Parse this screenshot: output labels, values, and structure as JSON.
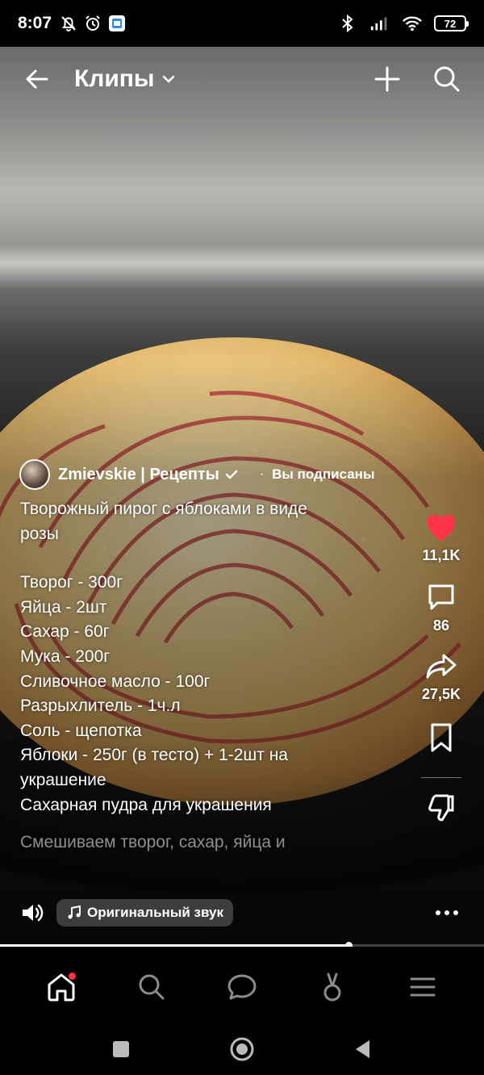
{
  "status_bar": {
    "time": "8:07",
    "battery": "72"
  },
  "topbar": {
    "title": "Клипы"
  },
  "post": {
    "author": "Zmievskie | Рецепты",
    "dot": "·",
    "subscribed": "Вы подписаны",
    "title_lines": [
      "Творожный пирог с яблоками в виде",
      "розы"
    ],
    "ingredients": [
      "Творог - 300г",
      "Яйца - 2шт",
      "Сахар - 60г",
      "Мука - 200г",
      "Сливочное масло - 100г",
      "Разрыхлитель - 1ч.л",
      "Соль - щепотка",
      "Яблоки - 250г (в тесто) + 1-2шт на",
      "украшение",
      "Сахарная пудра для украшения"
    ],
    "faded_line": "Смешиваем творог, сахар, яйца и"
  },
  "actions": {
    "likes": "11,1K",
    "comments": "86",
    "shares": "27,5K"
  },
  "sound": {
    "label": "Оригинальный звук"
  },
  "progress": {
    "fraction": 0.72
  },
  "colors": {
    "like": "#ff3347",
    "notification_dot": "#ff3347"
  },
  "icons": {
    "status": [
      "dnd-off-icon",
      "alarm-icon",
      "calendar-app-icon",
      "bluetooth-icon",
      "signal-icon",
      "wifi-icon"
    ],
    "nav": [
      "home-icon",
      "search-icon",
      "messages-icon",
      "clips-icon",
      "menu-icon"
    ]
  }
}
